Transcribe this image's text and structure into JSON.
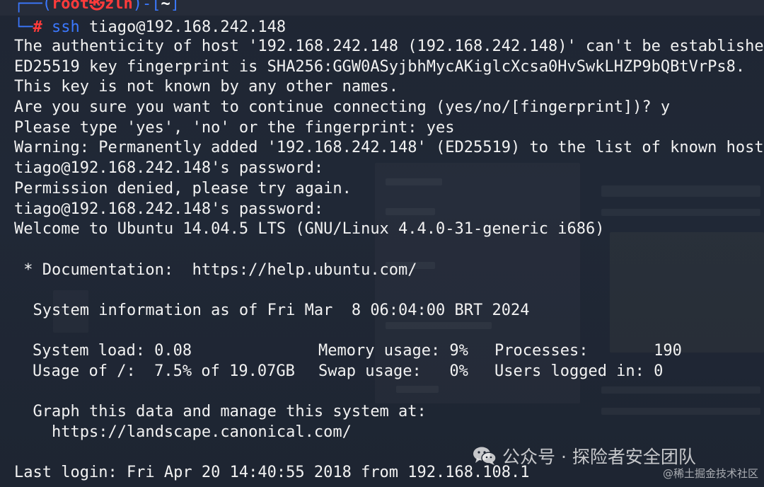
{
  "prompt": {
    "user": "root",
    "at_symbol": "㉿",
    "host": "zlh",
    "cwd": "~",
    "command": "ssh",
    "command_args": "tiago@192.168.242.148"
  },
  "session_output": [
    "The authenticity of host '192.168.242.148 (192.168.242.148)' can't be established",
    "ED25519 key fingerprint is SHA256:GGW0ASyjbhMycAKiglcXcsa0HvSwkLHZP9bQBtVrPs8.",
    "This key is not known by any other names.",
    "Are you sure you want to continue connecting (yes/no/[fingerprint])? y",
    "Please type 'yes', 'no' or the fingerprint: yes",
    "Warning: Permanently added '192.168.242.148' (ED25519) to the list of known hosts",
    "tiago@192.168.242.148's password:",
    "Permission denied, please try again.",
    "tiago@192.168.242.148's password:",
    "Welcome to Ubuntu 14.04.5 LTS (GNU/Linux 4.4.0-31-generic i686)"
  ],
  "motd": {
    "documentation": " * Documentation:  https://help.ubuntu.com/",
    "system_info": "  System information as of Fri Mar  8 06:04:00 BRT 2024",
    "stats": [
      [
        "System load: 0.08",
        "Memory usage: 9%",
        "Processes:       190"
      ],
      [
        "Usage of /:  7.5% of 19.07GB",
        "Swap usage:   0%",
        "Users logged in: 0"
      ]
    ],
    "graph_line": "  Graph this data and manage this system at:",
    "landscape_url": "    https://landscape.canonical.com/",
    "last_login": "Last login: Fri Apr 20 14:40:55 2018 from 192.168.108.1"
  },
  "watermarks": {
    "wechat_text": "公众号 · 探险者安全团队",
    "site_text": "@稀土掘金技术社区",
    "icon": "wechat-icon"
  },
  "colors": {
    "terminal_bg": "#1f2633",
    "text": "#f2f2f2",
    "prompt_blue": "#3b78ff",
    "prompt_red": "#ff3b3b"
  }
}
